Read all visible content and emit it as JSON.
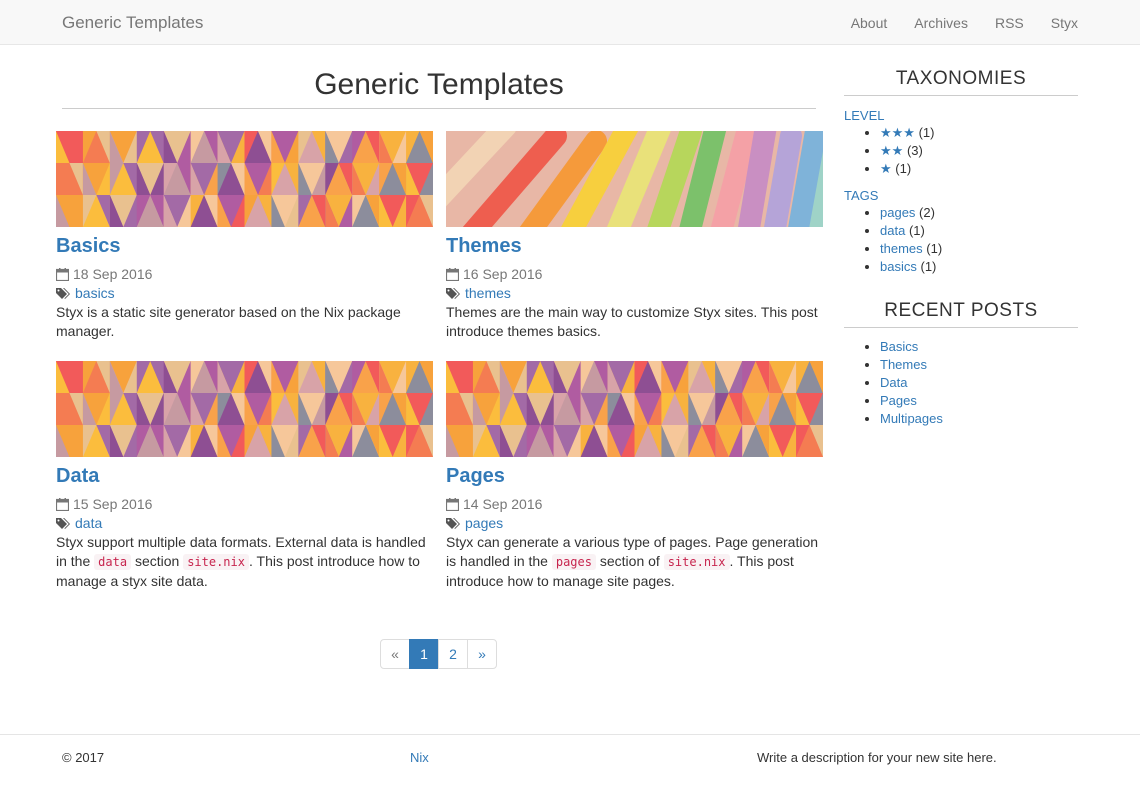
{
  "navbar": {
    "brand": "Generic Templates",
    "links": [
      "About",
      "Archives",
      "RSS",
      "Styx"
    ]
  },
  "main": {
    "title": "Generic Templates",
    "posts": [
      {
        "title": "Basics",
        "date": "18 Sep 2016",
        "tag": "basics",
        "banner": "geometric-triangles",
        "desc_parts": [
          "Styx is a static site generator based on the Nix package manager."
        ]
      },
      {
        "title": "Themes",
        "date": "16 Sep 2016",
        "tag": "themes",
        "banner": "chalk-sticks",
        "desc_parts": [
          "Themes are the main way to customize Styx sites. This post introduce themes basics."
        ]
      },
      {
        "title": "Data",
        "date": "15 Sep 2016",
        "tag": "data",
        "banner": "geometric-triangles",
        "desc_before": "Styx support multiple data formats. External data is handled in the",
        "desc_code1": "data",
        "desc_mid": "section",
        "desc_code2": "site.nix",
        "desc_after": ". This post introduce how to manage a styx site data."
      },
      {
        "title": "Pages",
        "date": "14 Sep 2016",
        "tag": "pages",
        "banner": "geometric-triangles",
        "desc_before": "Styx can generate a various type of pages. Page generation is handled in the",
        "desc_code1": "pages",
        "desc_mid": "section of",
        "desc_code2": "site.nix",
        "desc_after": ". This post introduce how to manage site pages."
      }
    ]
  },
  "pagination": {
    "prev": "«",
    "pages": [
      "1",
      "2"
    ],
    "active": "1",
    "next": "»"
  },
  "sidebar": {
    "taxonomies_heading": "TAXONOMIES",
    "level_label": "LEVEL",
    "levels": [
      {
        "stars": "★★★",
        "count": "(1)"
      },
      {
        "stars": "★★",
        "count": "(3)"
      },
      {
        "stars": "★",
        "count": "(1)"
      }
    ],
    "tags_label": "TAGS",
    "tags": [
      {
        "name": "pages",
        "count": "(2)"
      },
      {
        "name": "data",
        "count": "(1)"
      },
      {
        "name": "themes",
        "count": "(1)"
      },
      {
        "name": "basics",
        "count": "(1)"
      }
    ],
    "recent_heading": "RECENT POSTS",
    "recent": [
      "Basics",
      "Themes",
      "Data",
      "Pages",
      "Multipages"
    ]
  },
  "footer": {
    "copyright": "© 2017",
    "link": "Nix",
    "description": "Write a description for your new site here."
  },
  "colors": {
    "link": "#337ab7",
    "code_text": "#c7254e",
    "code_bg": "#f9f2f4",
    "navbar_bg": "#f8f8f8"
  }
}
